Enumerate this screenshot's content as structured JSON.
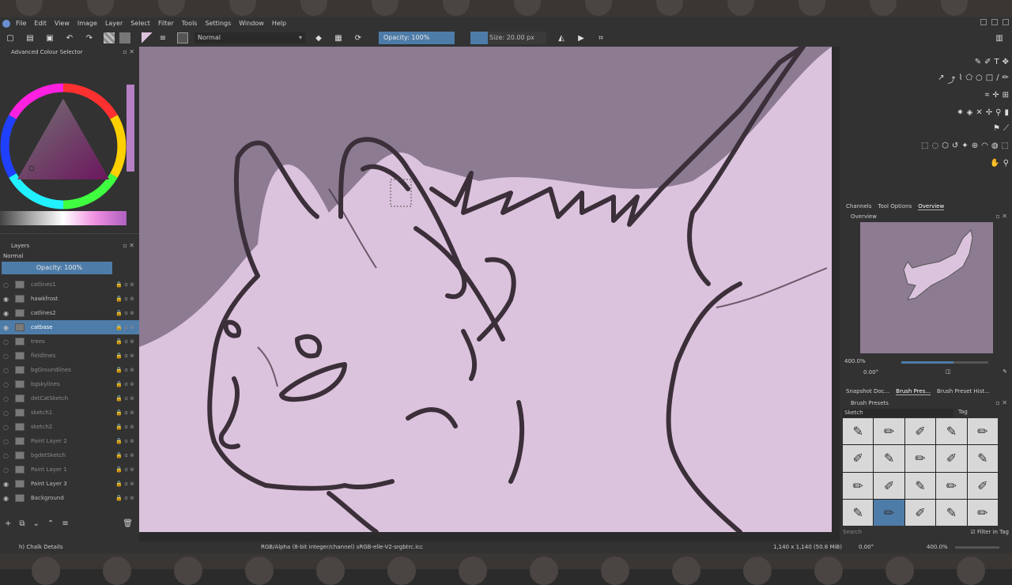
{
  "menu": [
    "File",
    "Edit",
    "View",
    "Image",
    "Layer",
    "Select",
    "Filter",
    "Tools",
    "Settings",
    "Window",
    "Help"
  ],
  "toolbar": {
    "blend_mode": "Normal",
    "opacity": "Opacity: 100%",
    "size": "Size: 20.00 px"
  },
  "colour_selector": {
    "title": "Advanced Colour Selector"
  },
  "layers": {
    "title": "Layers",
    "blend_mode": "Normal",
    "opacity": "Opacity: 100%",
    "items": [
      {
        "name": "catlines1",
        "visible": false,
        "selected": false
      },
      {
        "name": "hawkfrost",
        "visible": true,
        "selected": false
      },
      {
        "name": "catlines2",
        "visible": true,
        "selected": false
      },
      {
        "name": "catbase",
        "visible": true,
        "selected": true
      },
      {
        "name": "trees",
        "visible": false,
        "selected": false
      },
      {
        "name": "fieldlines",
        "visible": false,
        "selected": false
      },
      {
        "name": "bgGroundlines",
        "visible": false,
        "selected": false
      },
      {
        "name": "bgskylines",
        "visible": false,
        "selected": false
      },
      {
        "name": "detCatSketch",
        "visible": false,
        "selected": false
      },
      {
        "name": "sketch1",
        "visible": false,
        "selected": false
      },
      {
        "name": "sketch2",
        "visible": false,
        "selected": false
      },
      {
        "name": "Paint Layer 2",
        "visible": false,
        "selected": false
      },
      {
        "name": "bgdetSketch",
        "visible": false,
        "selected": false
      },
      {
        "name": "Paint Layer 1",
        "visible": false,
        "selected": false
      },
      {
        "name": "Paint Layer 3",
        "visible": true,
        "selected": false
      },
      {
        "name": "Background",
        "visible": true,
        "selected": false
      }
    ]
  },
  "right_panel": {
    "tabs": [
      "Channels",
      "Tool Options",
      "Overview"
    ],
    "overview_title": "Overview",
    "zoom": "400.0%",
    "angle": "0.00°",
    "dock_tabs": [
      "Snapshot Doc...",
      "Brush Pres...",
      "Brush Preset Hist..."
    ],
    "brush_presets_title": "Brush Presets",
    "brush_tag": "Sketch",
    "tag_label": "Tag",
    "search_placeholder": "Search",
    "filter_in_tag": "Filter in Tag"
  },
  "status": {
    "brush": "h) Chalk Details",
    "color_profile": "RGB/Alpha (8-bit integer/channel)  sRGB-elle-V2-srgbtrc.icc",
    "dimensions": "1,140 x 1,140 (50.8 MiB)",
    "rotation": "0.00°",
    "zoom": "400.0%"
  },
  "colors": {
    "canvas_bg": "#8d7b92",
    "fur": "#dcc3dd",
    "accent": "#4e7ca8"
  }
}
